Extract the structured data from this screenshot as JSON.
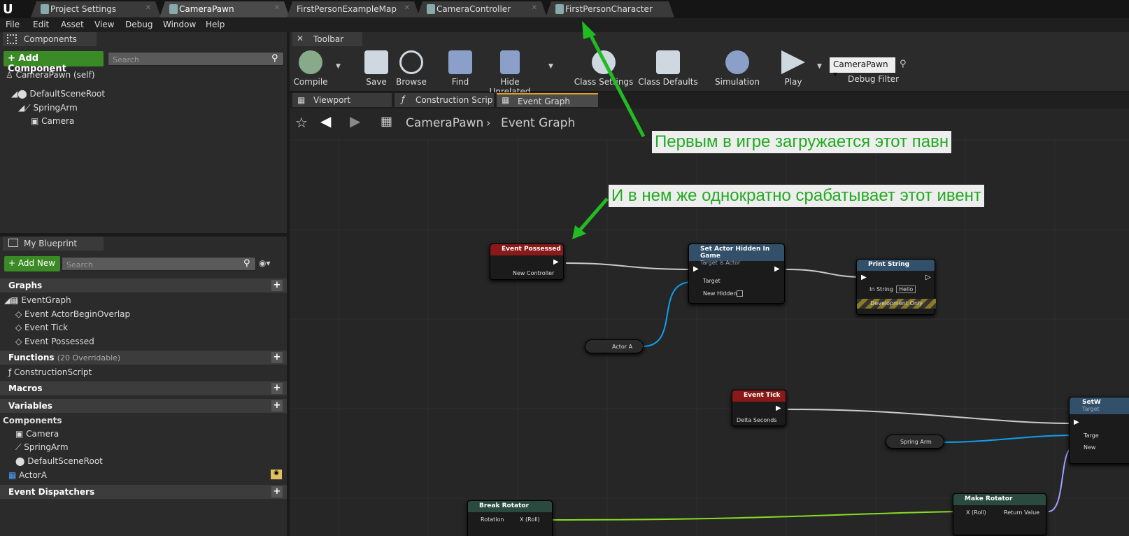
{
  "tabs": [
    "Project Settings",
    "CameraPawn",
    "FirstPersonExampleMap",
    "CameraController",
    "FirstPersonCharacter"
  ],
  "menu": [
    "File",
    "Edit",
    "Asset",
    "View",
    "Debug",
    "Window",
    "Help"
  ],
  "components_panel": {
    "title": "Components",
    "add_label": "+ Add Component",
    "search_placeholder": "Search",
    "self": "CameraPawn (self)",
    "tree": [
      "DefaultSceneRoot",
      "SpringArm",
      "Camera"
    ]
  },
  "toolbar": {
    "title": "Toolbar",
    "buttons": [
      "Compile",
      "Save",
      "Browse",
      "Find",
      "Hide Unrelated",
      "Class Settings",
      "Class Defaults",
      "Simulation",
      "Play"
    ],
    "debug_value": "CameraPawn",
    "debug_label": "Debug Filter"
  },
  "editor_tabs": [
    "Viewport",
    "Construction Scrip",
    "Event Graph"
  ],
  "breadcrumb": {
    "root": "CameraPawn",
    "current": "Event Graph"
  },
  "my_blueprint": {
    "title": "My Blueprint",
    "add_label": "+ Add New",
    "search_placeholder": "Search",
    "graphs_label": "Graphs",
    "event_graph": "EventGraph",
    "events": [
      "Event ActorBeginOverlap",
      "Event Tick",
      "Event Possessed"
    ],
    "functions_label": "Functions",
    "functions_count": "(20 Overridable)",
    "functions": [
      "ConstructionScript"
    ],
    "macros_label": "Macros",
    "variables_label": "Variables",
    "components_label": "Components",
    "components": [
      "Camera",
      "SpringArm",
      "DefaultSceneRoot"
    ],
    "actor_var": "ActorA",
    "dispatchers_label": "Event Dispatchers"
  },
  "annotations": [
    "Первым в игре загружается этот павн",
    "И в нем же однократно срабатывает этот ивент"
  ],
  "nodes": {
    "possessed": {
      "title": "Event Possessed",
      "pin": "New Controller"
    },
    "hidden": {
      "title": "Set Actor Hidden In Game",
      "sub": "Target is Actor",
      "pins": [
        "Target",
        "New Hidden"
      ]
    },
    "print": {
      "title": "Print String",
      "pin": "In String",
      "value": "Hello",
      "dev": "Development Only"
    },
    "actor_a": "Actor A",
    "tick": {
      "title": "Event Tick",
      "pin": "Delta Seconds"
    },
    "spring": "Spring Arm",
    "setw": {
      "title": "SetW",
      "sub": "Target",
      "pins": [
        "Targe",
        "New"
      ]
    },
    "break": {
      "title": "Break Rotator",
      "pins": [
        "Rotation",
        "X (Roll)"
      ]
    },
    "make": {
      "title": "Make Rotator",
      "pins": [
        "X (Roll)",
        "Return Value"
      ]
    }
  }
}
